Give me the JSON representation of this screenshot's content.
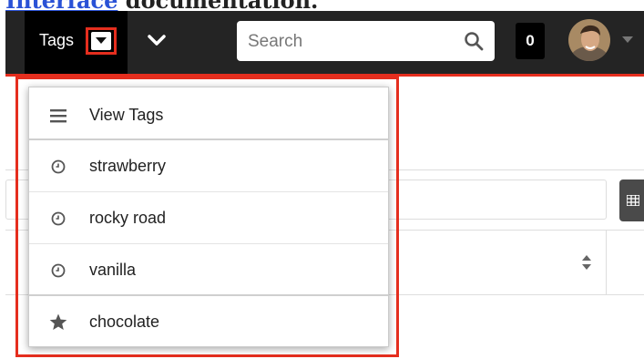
{
  "doc": {
    "link_text": "Interface",
    "text": "documentation."
  },
  "navbar": {
    "tags_label": "Tags",
    "search": {
      "placeholder": "Search"
    },
    "notification_count": "0"
  },
  "tags_dropdown": {
    "items": [
      {
        "label": "View Tags",
        "icon": "list-icon"
      },
      {
        "label": "strawberry",
        "icon": "clock-icon"
      },
      {
        "label": "rocky road",
        "icon": "clock-icon"
      },
      {
        "label": "vanilla",
        "icon": "clock-icon"
      },
      {
        "label": "chocolate",
        "icon": "star-icon"
      }
    ]
  },
  "colors": {
    "navbar": "#242424",
    "highlight": "#e52e1e",
    "accent_line": "#e52e1e"
  }
}
